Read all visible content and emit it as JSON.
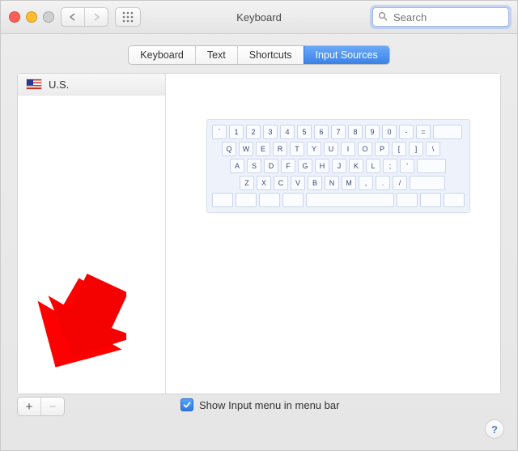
{
  "window": {
    "title": "Keyboard"
  },
  "search": {
    "placeholder": "Search",
    "value": ""
  },
  "tabs": [
    {
      "label": "Keyboard",
      "active": false
    },
    {
      "label": "Text",
      "active": false
    },
    {
      "label": "Shortcuts",
      "active": false
    },
    {
      "label": "Input Sources",
      "active": true
    }
  ],
  "sources": [
    {
      "label": "U.S.",
      "flag": "us"
    }
  ],
  "keyboard_preview": {
    "row1": [
      "`",
      "1",
      "2",
      "3",
      "4",
      "5",
      "6",
      "7",
      "8",
      "9",
      "0",
      "-",
      "="
    ],
    "row2": [
      "Q",
      "W",
      "E",
      "R",
      "T",
      "Y",
      "U",
      "I",
      "O",
      "P",
      "[",
      "]",
      "\\"
    ],
    "row3": [
      "A",
      "S",
      "D",
      "F",
      "G",
      "H",
      "J",
      "K",
      "L",
      ";",
      "'"
    ],
    "row4": [
      "Z",
      "X",
      "C",
      "V",
      "B",
      "N",
      "M",
      ",",
      ".",
      "/"
    ]
  },
  "buttons": {
    "add": "+",
    "remove": "−",
    "help": "?"
  },
  "checkbox": {
    "label": "Show Input menu in menu bar",
    "checked": true
  }
}
